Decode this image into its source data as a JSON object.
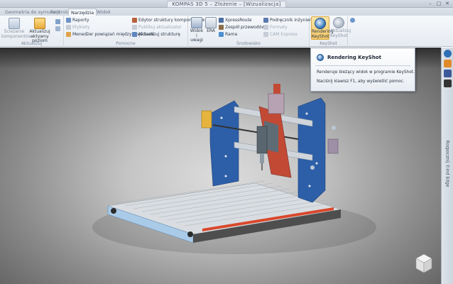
{
  "window": {
    "title": "KOMPAS 3D 5 – Złożenie – [Wizualizacja]",
    "controls": [
      "–",
      "□",
      "✕"
    ]
  },
  "tabs": [
    {
      "label": "Geometria do symulacji",
      "active": false
    },
    {
      "label": "Kontrola",
      "active": false
    },
    {
      "label": "Narzędzia",
      "active": true
    },
    {
      "label": "Widok",
      "active": false
    }
  ],
  "ribbon": {
    "aktualizuj": {
      "label": "Aktualizuj",
      "buttons": {
        "sciezanie": "Ściezanie komponentów",
        "aktywny": "Aktualizuj aktywny poziom"
      }
    },
    "pomocne": {
      "label": "Pomocne",
      "items": {
        "raporty": "Raporty",
        "etykiety": "Etykiety",
        "menedzer": "Menedżer powiązań między częściami",
        "edytor": "Edytor struktury komponentów",
        "publikuj": "Publikuj aktualizator",
        "aktualizuj_strukture": "Aktualizuj strukturę"
      }
    },
    "srodowisko": {
      "label": "Środowisko",
      "items": {
        "widok": "Widok i uwagi",
        "era": "ERA",
        "xpress": "XpressRoute",
        "zespol": "Zespół przewodów",
        "rama": "Rama",
        "podrecznik": "Podręcznik inżyniera",
        "formaty": "Formaty",
        "cam": "CAM Express"
      }
    },
    "keyshot": {
      "label": "KeyShot",
      "items": {
        "rendering": "Rendering KeyShot",
        "aktualizuj": "Aktualizuj KeyShot"
      }
    }
  },
  "tooltip": {
    "title": "Rendering KeyShot",
    "line1": "Renderuje bieżący widok w programie KeyShot.",
    "line2": "Naciśnij klawisz F1, aby wyświetlić pomoc."
  },
  "sidebar": {
    "text": "Rozpocznij ©ind Edge"
  },
  "colors": {
    "accent": "#2e6fb5",
    "highlight": "#f3c766",
    "machine_frame": "#2d5fa8",
    "rail": "#d8dde2"
  }
}
